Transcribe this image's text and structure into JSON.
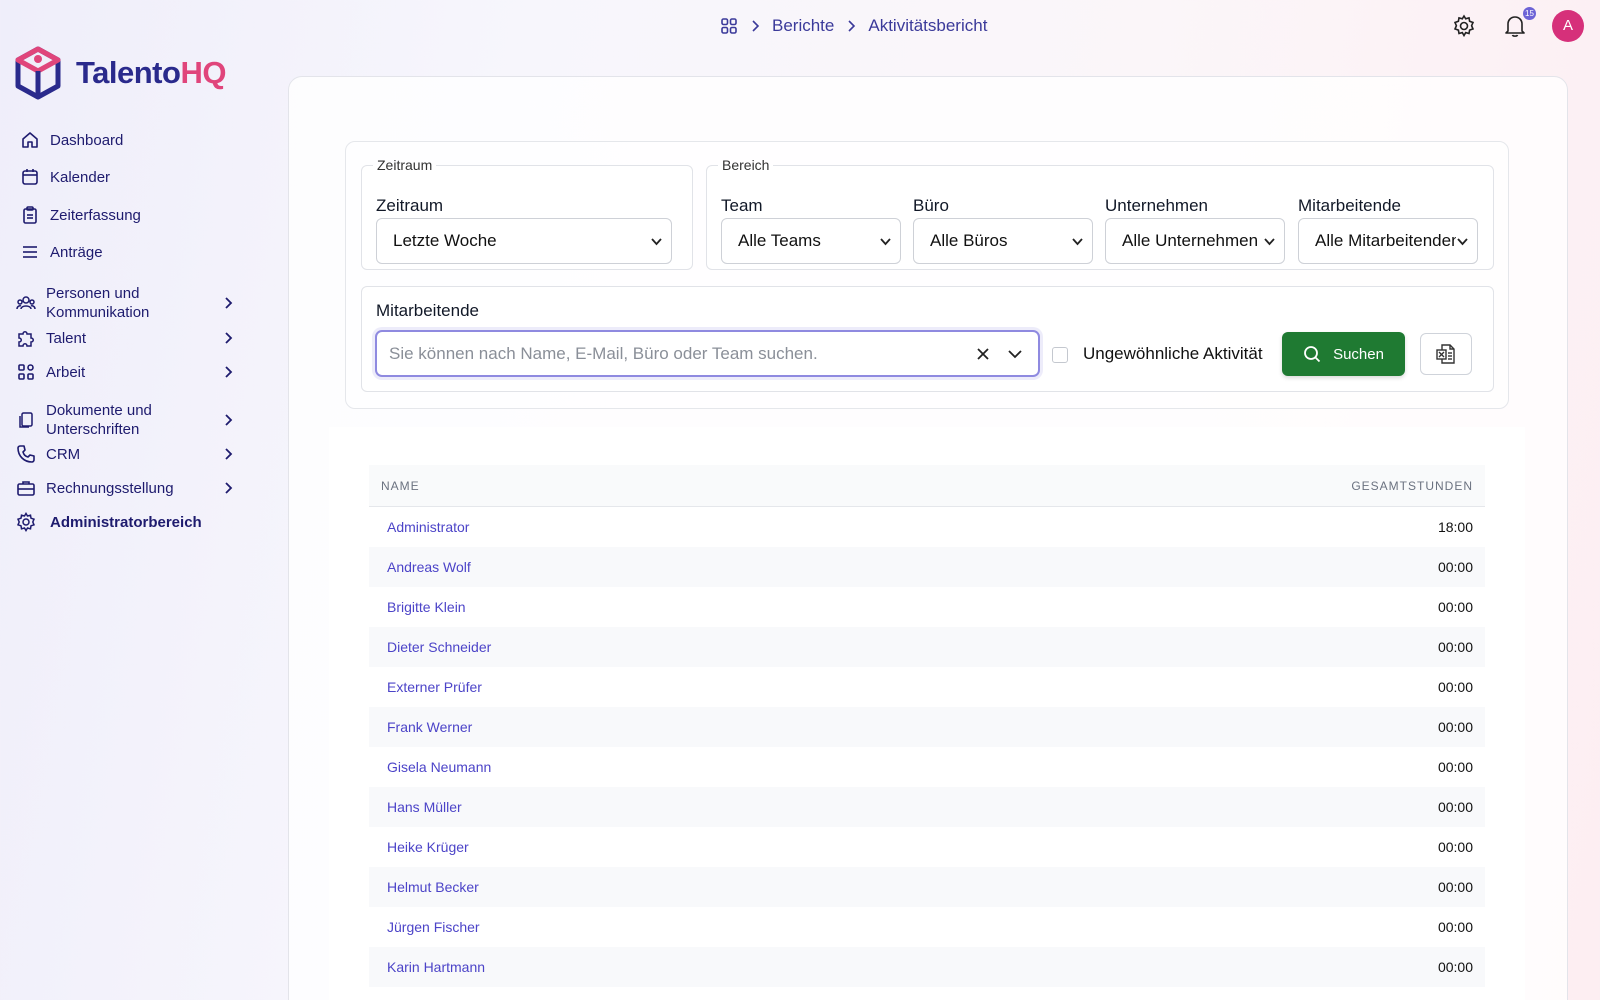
{
  "brand": {
    "name_part1": "Talento",
    "name_part2": "HQ",
    "colors": {
      "primary": "#2a2a8c",
      "accent": "#e0457b"
    }
  },
  "breadcrumb": {
    "home_icon": "grid-icon",
    "items": [
      "Berichte",
      "Aktivitätsbericht"
    ]
  },
  "header": {
    "notification_count": "15",
    "avatar_initial": "A"
  },
  "sidebar": {
    "items": [
      {
        "label": "Dashboard",
        "icon": "home-icon"
      },
      {
        "label": "Kalender",
        "icon": "calendar-icon"
      },
      {
        "label": "Zeiterfassung",
        "icon": "clipboard-icon"
      },
      {
        "label": "Anträge",
        "icon": "list-icon"
      },
      {
        "label": "Personen und Kommunikation",
        "icon": "people-icon",
        "expandable": true
      },
      {
        "label": "Talent",
        "icon": "puzzle-icon",
        "expandable": true
      },
      {
        "label": "Arbeit",
        "icon": "apps-icon",
        "expandable": true
      },
      {
        "label": "Dokumente und Unterschriften",
        "icon": "documents-icon",
        "expandable": true
      },
      {
        "label": "CRM",
        "icon": "phone-icon",
        "expandable": true
      },
      {
        "label": "Rechnungsstellung",
        "icon": "briefcase-icon",
        "expandable": true
      },
      {
        "label": "Administratorbereich",
        "icon": "gear-icon"
      }
    ]
  },
  "filters": {
    "zeitraum_legend": "Zeitraum",
    "zeitraum_label": "Zeitraum",
    "zeitraum_value": "Letzte Woche",
    "bereich_legend": "Bereich",
    "team_label": "Team",
    "team_value": "Alle Teams",
    "buero_label": "Büro",
    "buero_value": "Alle Büros",
    "unternehmen_label": "Unternehmen",
    "unternehmen_value": "Alle Unternehmen",
    "mitarbeitende_label": "Mitarbeitende",
    "mitarbeitende_value": "Alle Mitarbeitenden"
  },
  "search": {
    "label": "Mitarbeitende",
    "placeholder": "Sie können nach Name, E-Mail, Büro oder Team suchen.",
    "value": "",
    "checkbox_label": "Ungewöhnliche Aktivität",
    "checkbox_checked": false,
    "search_button": "Suchen",
    "export_icon": "excel-icon"
  },
  "table": {
    "columns": [
      "NAME",
      "GESAMTSTUNDEN"
    ],
    "rows": [
      {
        "name": "Administrator",
        "hours": "18:00"
      },
      {
        "name": "Andreas Wolf",
        "hours": "00:00"
      },
      {
        "name": "Brigitte Klein",
        "hours": "00:00"
      },
      {
        "name": "Dieter Schneider",
        "hours": "00:00"
      },
      {
        "name": "Externer Prüfer",
        "hours": "00:00"
      },
      {
        "name": "Frank Werner",
        "hours": "00:00"
      },
      {
        "name": "Gisela Neumann",
        "hours": "00:00"
      },
      {
        "name": "Hans Müller",
        "hours": "00:00"
      },
      {
        "name": "Heike Krüger",
        "hours": "00:00"
      },
      {
        "name": "Helmut Becker",
        "hours": "00:00"
      },
      {
        "name": "Jürgen Fischer",
        "hours": "00:00"
      },
      {
        "name": "Karin Hartmann",
        "hours": "00:00"
      }
    ]
  }
}
